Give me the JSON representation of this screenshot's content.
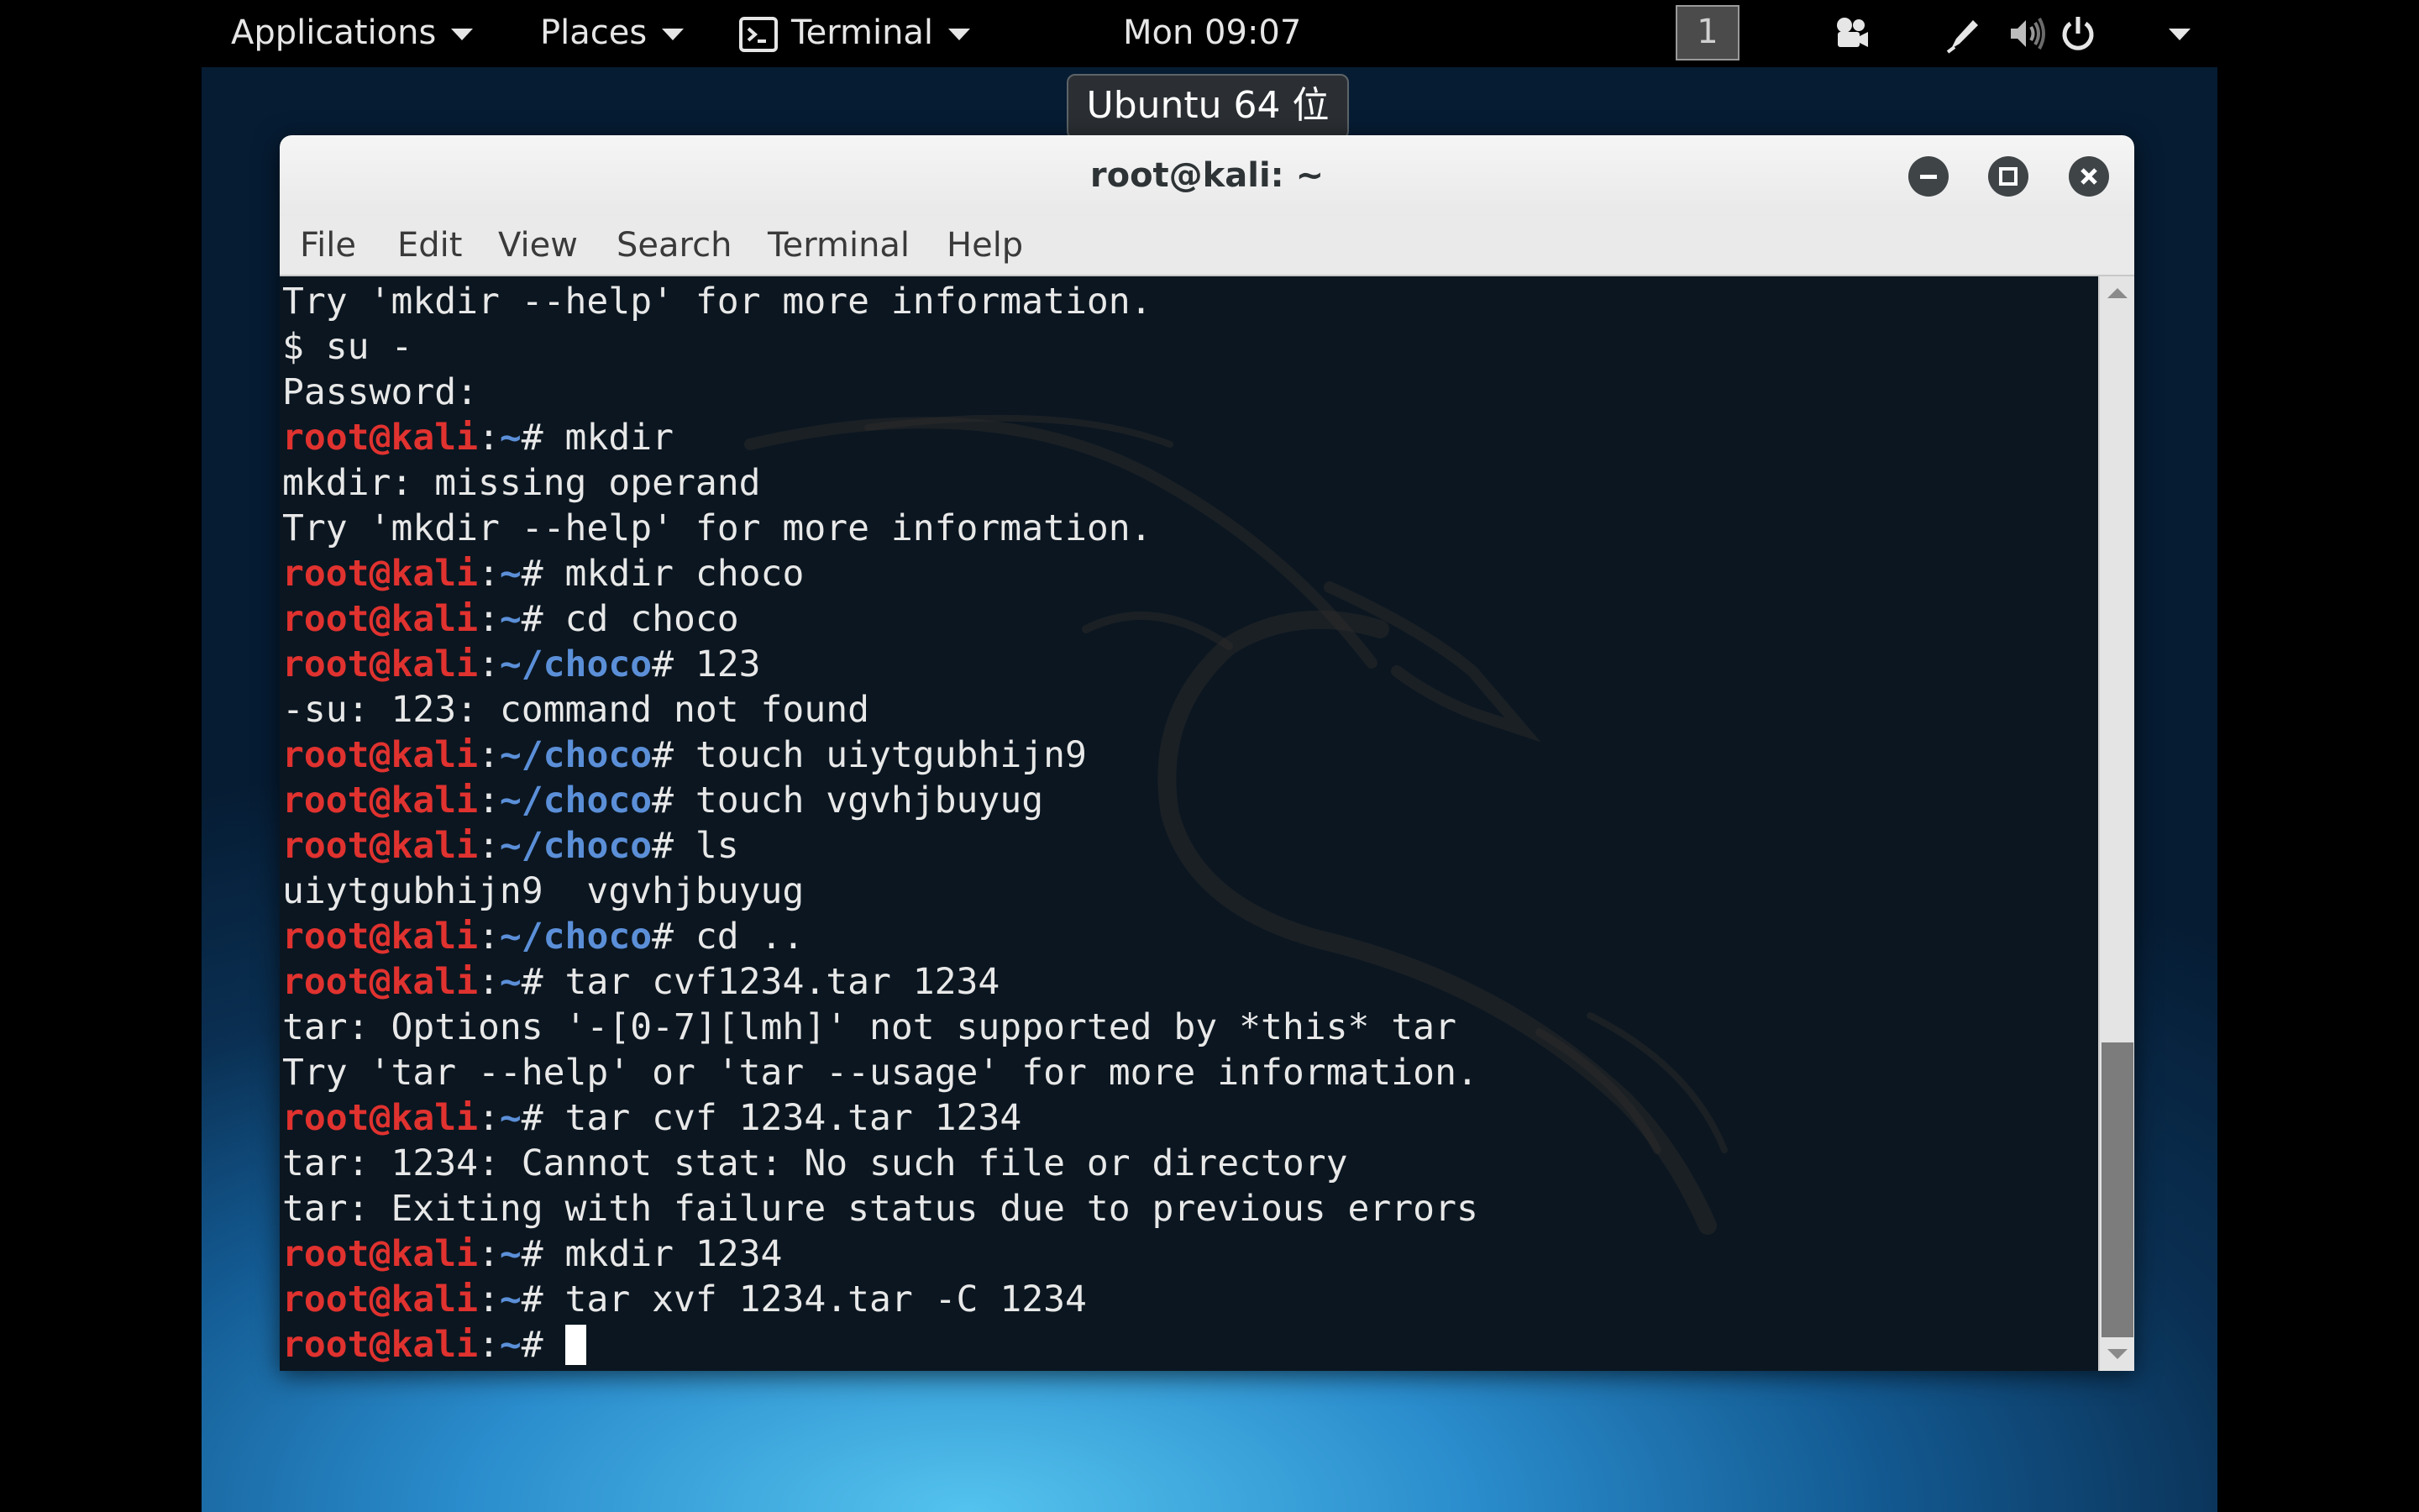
{
  "topbar": {
    "applications_label": "Applications",
    "places_label": "Places",
    "terminal_app_label": "Terminal",
    "clock": "Mon 09:07",
    "workspace_number": "1"
  },
  "tooltip": {
    "text": "Ubuntu 64 位"
  },
  "window": {
    "title": "root@kali: ~",
    "menu": [
      "File",
      "Edit",
      "View",
      "Search",
      "Terminal",
      "Help"
    ]
  },
  "terminal": {
    "lines": [
      {
        "text": "Try 'mkdir --help' for more information."
      },
      {
        "text": "$ su -"
      },
      {
        "text": "Password:"
      },
      {
        "user": "root@kali",
        "path": "~",
        "cmd": " mkdir"
      },
      {
        "text": "mkdir: missing operand"
      },
      {
        "text": "Try 'mkdir --help' for more information."
      },
      {
        "user": "root@kali",
        "path": "~",
        "cmd": " mkdir choco"
      },
      {
        "user": "root@kali",
        "path": "~",
        "cmd": " cd choco"
      },
      {
        "user": "root@kali",
        "path": "~/choco",
        "cmd": " 123"
      },
      {
        "text": "-su: 123: command not found"
      },
      {
        "user": "root@kali",
        "path": "~/choco",
        "cmd": " touch uiytgubhijn9"
      },
      {
        "user": "root@kali",
        "path": "~/choco",
        "cmd": " touch vgvhjbuyug"
      },
      {
        "user": "root@kali",
        "path": "~/choco",
        "cmd": " ls"
      },
      {
        "text": "uiytgubhijn9  vgvhjbuyug"
      },
      {
        "user": "root@kali",
        "path": "~/choco",
        "cmd": " cd .."
      },
      {
        "user": "root@kali",
        "path": "~",
        "cmd": " tar cvf1234.tar 1234"
      },
      {
        "text": "tar: Options '-[0-7][lmh]' not supported by *this* tar"
      },
      {
        "text": "Try 'tar --help' or 'tar --usage' for more information."
      },
      {
        "user": "root@kali",
        "path": "~",
        "cmd": " tar cvf 1234.tar 1234"
      },
      {
        "text": "tar: 1234: Cannot stat: No such file or directory"
      },
      {
        "text": "tar: Exiting with failure status due to previous errors"
      },
      {
        "user": "root@kali",
        "path": "~",
        "cmd": " mkdir 1234"
      },
      {
        "user": "root@kali",
        "path": "~",
        "cmd": " tar xvf 1234.tar -C 1234"
      },
      {
        "user": "root@kali",
        "path": "~",
        "cmd": " ",
        "cursor": true
      }
    ]
  },
  "scrollbar": {
    "thumb_start_fraction": 0.7,
    "thumb_end_fraction": 1.0
  },
  "icons": {
    "terminal_app": "terminal-icon",
    "camera": "camera-icon",
    "pen": "pen-icon",
    "volume": "volume-icon",
    "power": "power-icon",
    "minimize": "minimize-icon",
    "maximize": "maximize-icon",
    "close": "close-icon"
  },
  "colors": {
    "prompt_user": "#e0322f",
    "prompt_path": "#5b8fd8",
    "terminal_bg": "#0b1620",
    "desktop_accent": "#2a8ccc"
  }
}
